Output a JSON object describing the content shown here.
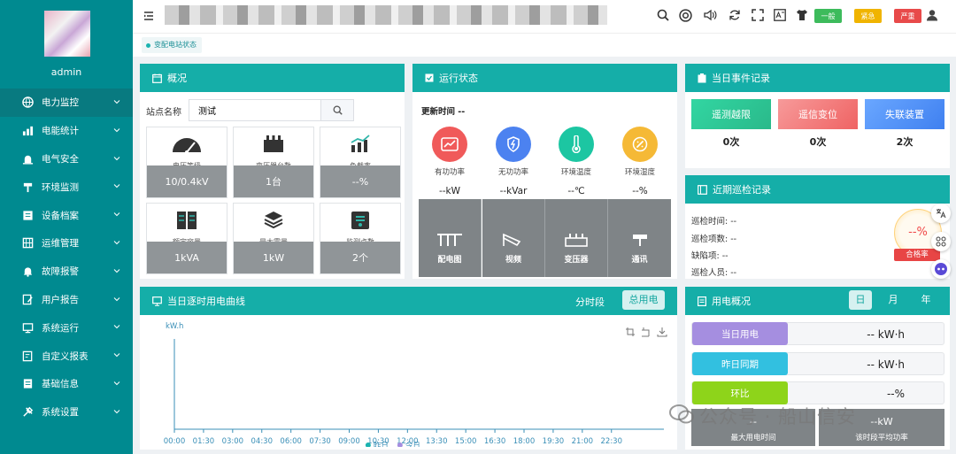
{
  "sidebar": {
    "username": "admin",
    "items": [
      {
        "label": "电力监控"
      },
      {
        "label": "电能统计"
      },
      {
        "label": "电气安全"
      },
      {
        "label": "环境监测"
      },
      {
        "label": "设备档案"
      },
      {
        "label": "运维管理"
      },
      {
        "label": "故障报警"
      },
      {
        "label": "用户报告"
      },
      {
        "label": "系统运行"
      },
      {
        "label": "自定义报表"
      },
      {
        "label": "基础信息"
      },
      {
        "label": "系统设置"
      }
    ]
  },
  "topbar": {
    "levels": {
      "normal": "一般",
      "urgent": "紧急",
      "severe": "严重"
    },
    "colors": {
      "normal": "#3dbb5c",
      "urgent": "#f0b400",
      "severe": "#e84a4a"
    }
  },
  "breadcrumb": {
    "tab": "变配电站状态"
  },
  "overview": {
    "title": "概况",
    "station_label": "站点名称",
    "station_value": "测试",
    "tiles": [
      {
        "label": "电压等级",
        "value": "10/0.4kV"
      },
      {
        "label": "变压器台数",
        "value": "1台"
      },
      {
        "label": "负载率",
        "value": "--%"
      },
      {
        "label": "额定容量",
        "value": "1kVA"
      },
      {
        "label": "最大需量",
        "value": "1kW"
      },
      {
        "label": "监测点数",
        "value": "2个"
      }
    ]
  },
  "status": {
    "title": "运行状态",
    "update_time": "更新时间 --",
    "metrics": [
      {
        "label": "有功功率",
        "value": "--kW",
        "color": "#f05a5a"
      },
      {
        "label": "无功功率",
        "value": "--kVar",
        "color": "#4c82f0"
      },
      {
        "label": "环境温度",
        "value": "--℃",
        "color": "#1cc6a2"
      },
      {
        "label": "环境湿度",
        "value": "--%",
        "color": "#f5b936"
      }
    ],
    "nav": [
      {
        "label": "配电图"
      },
      {
        "label": "视频"
      },
      {
        "label": "变压器"
      },
      {
        "label": "通讯"
      }
    ]
  },
  "events": {
    "title": "当日事件记录",
    "items": [
      {
        "label": "遥测越限",
        "value": "0次",
        "color": "#3cc79a"
      },
      {
        "label": "遥信变位",
        "value": "0次",
        "color": "#f27272"
      },
      {
        "label": "失联装置",
        "value": "2次",
        "color": "#4b8ff5"
      }
    ]
  },
  "inspection": {
    "title": "近期巡检记录",
    "fields": [
      "巡检时间: --",
      "巡检项数: --",
      "缺陷项: --",
      "巡检人员: --"
    ],
    "rate_value": "--%",
    "rate_label": "合格率"
  },
  "curve": {
    "title": "当日逐时用电曲线",
    "tab1": "分时段",
    "tab2": "总用电",
    "unit": "kW.h",
    "times": [
      "00:00",
      "01:30",
      "03:00",
      "04:30",
      "06:00",
      "07:30",
      "09:00",
      "10:30",
      "12:00",
      "13:30",
      "15:00",
      "16:30",
      "18:00",
      "19:30",
      "21:00",
      "22:30"
    ],
    "legend": [
      "昨日",
      "今日"
    ]
  },
  "usage": {
    "title": "用电概况",
    "tabs": [
      "日",
      "月",
      "年"
    ],
    "rows": [
      {
        "label": "当日用电",
        "value": "-- kW·h",
        "color": "#a58ee0"
      },
      {
        "label": "昨日同期",
        "value": "-- kW·h",
        "color": "#32c0e0"
      },
      {
        "label": "环比",
        "value": "--%",
        "color": "#8ed41a"
      }
    ],
    "bottom": [
      {
        "value": "--",
        "label": "最大用电时间"
      },
      {
        "value": "--kW",
        "label": "该时段平均功率"
      }
    ]
  },
  "watermark": "公众号 · 船山信安"
}
